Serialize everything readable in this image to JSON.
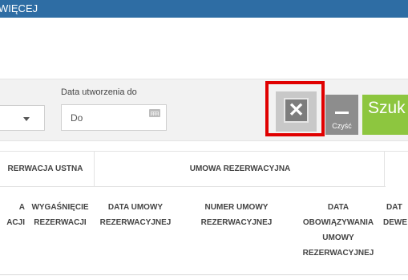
{
  "topbar": {
    "title": "WIĘCEJ"
  },
  "filters": {
    "date_to_label": "Data utworzenia do",
    "date_to_placeholder": "Do"
  },
  "buttons": {
    "clear_label": "Czyść",
    "search_label": "Szuk"
  },
  "colors": {
    "topbar": "#2e6da4",
    "search": "#8dc63f",
    "clear": "#8d8d8d",
    "highlight": "#e00000"
  },
  "table": {
    "groups": [
      "RERWACJA USTNA",
      "UMOWA REZERWACYJNA"
    ],
    "columns": [
      [
        "A",
        "ACJI"
      ],
      [
        "WYGAŚNIĘCIE",
        "REZERWACJI"
      ],
      [
        "DATA UMOWY",
        "REZERWACYJNEJ"
      ],
      [
        "NUMER UMOWY",
        "REZERWACYJNEJ"
      ],
      [
        "DATA",
        "OBOWIĄZYWANIA",
        "UMOWY",
        "REZERWACYJNEJ"
      ],
      [
        "DAT",
        "DEWE"
      ]
    ]
  }
}
